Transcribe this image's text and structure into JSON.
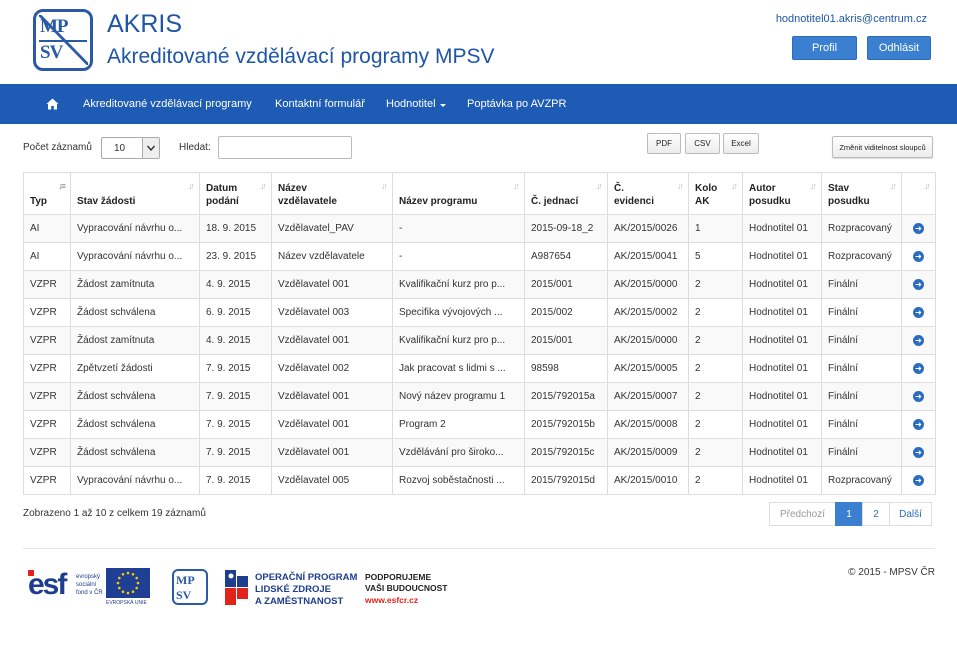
{
  "header": {
    "logo_top": "MP",
    "logo_bottom": "SV",
    "title": "AKRIS",
    "subtitle": "Akreditované vzdělávací programy MPSV",
    "user_email": "hodnotitel01.akris@centrum.cz",
    "profile_label": "Profil",
    "logout_label": "Odhlásit"
  },
  "nav": {
    "home_icon": "home-icon",
    "items": [
      {
        "label": "Akreditované vzdělávací programy"
      },
      {
        "label": "Kontaktní formulář"
      },
      {
        "label": "Hodnotitel"
      },
      {
        "label": "Poptávka po AVZPR"
      }
    ]
  },
  "controls": {
    "page_size_label": "Počet záznamů",
    "page_size_value": "10",
    "search_label": "Hledat:",
    "search_value": "",
    "export_pdf": "PDF",
    "export_csv": "CSV",
    "export_excel": "Excel",
    "columns_button": "Změnit viditelnost sloupců"
  },
  "table": {
    "headers": [
      {
        "l1": "",
        "l2": "Typ"
      },
      {
        "l1": "",
        "l2": "Stav žádosti"
      },
      {
        "l1": "Datum",
        "l2": "podání"
      },
      {
        "l1": "Název",
        "l2": "vzdělavatele"
      },
      {
        "l1": "",
        "l2": "Název programu"
      },
      {
        "l1": "",
        "l2": "Č. jednací"
      },
      {
        "l1": "Č.",
        "l2": "evidenci"
      },
      {
        "l1": "Kolo",
        "l2": "AK"
      },
      {
        "l1": "Autor",
        "l2": "posudku"
      },
      {
        "l1": "Stav",
        "l2": "posudku"
      },
      {
        "l1": "",
        "l2": ""
      }
    ],
    "rows": [
      [
        "AI",
        "Vypracování návrhu o...",
        "18. 9. 2015",
        "Vzdělavatel_PAV",
        "-",
        "2015-09-18_2",
        "AK/2015/0026",
        "1",
        "Hodnotitel 01",
        "Rozpracovaný"
      ],
      [
        "AI",
        "Vypracování návrhu o...",
        "23. 9. 2015",
        "Název vzdělavatele",
        "-",
        "A987654",
        "AK/2015/0041",
        "5",
        "Hodnotitel 01",
        "Rozpracovaný"
      ],
      [
        "VZPR",
        "Žádost zamítnuta",
        "4. 9. 2015",
        "Vzdělavatel 001",
        "Kvalifikační kurz pro p...",
        "2015/001",
        "AK/2015/0000",
        "2",
        "Hodnotitel 01",
        "Finální"
      ],
      [
        "VZPR",
        "Žádost schválena",
        "6. 9. 2015",
        "Vzdělavatel 003",
        "Specifika vývojových ...",
        "2015/002",
        "AK/2015/0002",
        "2",
        "Hodnotitel 01",
        "Finální"
      ],
      [
        "VZPR",
        "Žádost zamítnuta",
        "4. 9. 2015",
        "Vzdělavatel 001",
        "Kvalifikační kurz pro p...",
        "2015/001",
        "AK/2015/0000",
        "2",
        "Hodnotitel 01",
        "Finální"
      ],
      [
        "VZPR",
        "Zpětvzetí žádosti",
        "7. 9. 2015",
        "Vzdělavatel 002",
        "Jak pracovat s lidmi s ...",
        "98598",
        "AK/2015/0005",
        "2",
        "Hodnotitel 01",
        "Finální"
      ],
      [
        "VZPR",
        "Žádost schválena",
        "7. 9. 2015",
        "Vzdělavatel 001",
        "Nový název programu 1",
        "2015/792015a",
        "AK/2015/0007",
        "2",
        "Hodnotitel 01",
        "Finální"
      ],
      [
        "VZPR",
        "Žádost schválena",
        "7. 9. 2015",
        "Vzdělavatel 001",
        "Program 2",
        "2015/792015b",
        "AK/2015/0008",
        "2",
        "Hodnotitel 01",
        "Finální"
      ],
      [
        "VZPR",
        "Žádost schválena",
        "7. 9. 2015",
        "Vzdělavatel 001",
        "Vzdělávání pro široko...",
        "2015/792015c",
        "AK/2015/0009",
        "2",
        "Hodnotitel 01",
        "Finální"
      ],
      [
        "VZPR",
        "Vypracování návrhu o...",
        "7. 9. 2015",
        "Vzdělavatel 005",
        "Rozvoj soběstačnosti ...",
        "2015/792015d",
        "AK/2015/0010",
        "2",
        "Hodnotitel 01",
        "Rozpracovaný"
      ]
    ],
    "row_action_icon": "arrow-right-circle-icon"
  },
  "footer": {
    "info": "Zobrazeno 1 až 10 z celkem 19 záznamů",
    "pager": {
      "prev": "Předchozí",
      "pages": [
        "1",
        "2"
      ],
      "next": "Další"
    },
    "esf_mark": "esf",
    "esf_text": [
      "evropský",
      "sociální",
      "fond v ČR"
    ],
    "eu_text": "EVROPSKÁ UNIE",
    "mpsv_top": "MP",
    "mpsv_bottom": "SV",
    "op_lines": [
      "OPERAČNÍ PROGRAM",
      "LIDSKÉ ZDROJE",
      "A ZAMĚSTNANOST"
    ],
    "support_lines": [
      "PODPORUJEME",
      "VAŠI BUDOUCNOST"
    ],
    "support_url": "www.esfcr.cz",
    "copyright": "© 2015 - MPSV ČR"
  }
}
